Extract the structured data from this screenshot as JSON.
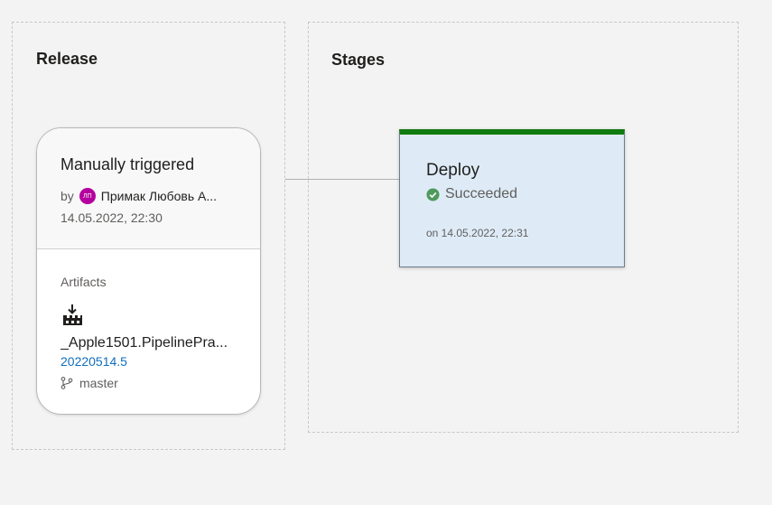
{
  "release": {
    "title": "Release",
    "trigger": {
      "title": "Manually triggered",
      "by_label": "by",
      "avatar_initials": "ЛП",
      "author": "Примак Любовь А...",
      "date": "14.05.2022, 22:30"
    },
    "artifacts": {
      "label": "Artifacts",
      "icon": "build-artifact-icon",
      "name": "_Apple1501.PipelinePra...",
      "version": "20220514.5",
      "branch_icon": "branch-icon",
      "branch": "master"
    }
  },
  "stages": {
    "title": "Stages",
    "items": [
      {
        "name": "Deploy",
        "status_icon": "check-circle-icon",
        "status": "Succeeded",
        "date": "on 14.05.2022, 22:31"
      }
    ]
  },
  "colors": {
    "background": "#f3f3f3",
    "success": "#107c10",
    "stage_fill": "#deebf7",
    "avatar": "#b4009e",
    "link": "#106ebe"
  }
}
